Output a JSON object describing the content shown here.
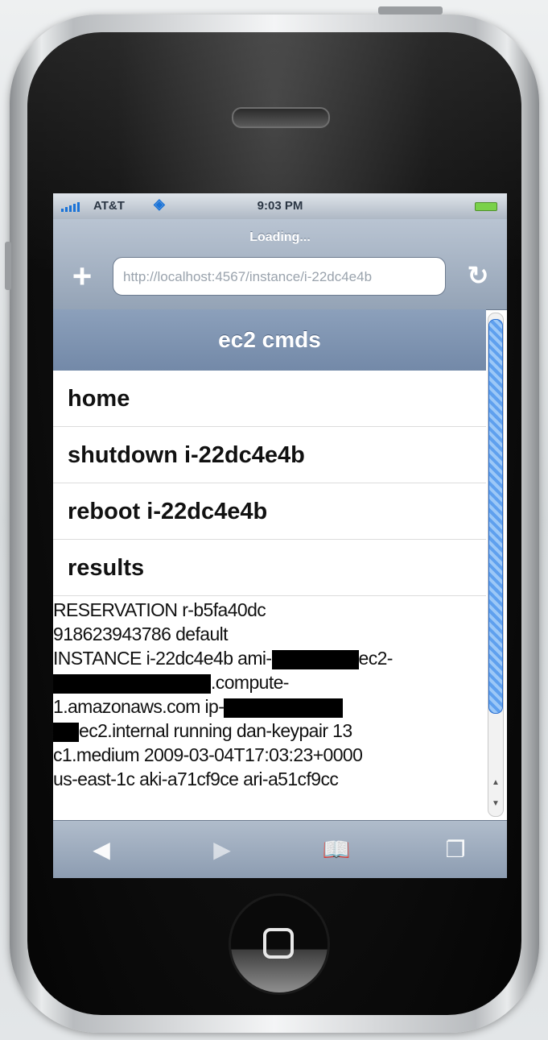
{
  "status_bar": {
    "carrier": "AT&T",
    "time": "9:03 PM"
  },
  "browser": {
    "loading_text": "Loading...",
    "url": "http://localhost:4567/instance/i-22dc4e4b"
  },
  "page": {
    "title": "ec2 cmds",
    "menu_items": [
      {
        "label": "home"
      },
      {
        "label": "shutdown i-22dc4e4b"
      },
      {
        "label": "reboot i-22dc4e4b"
      },
      {
        "label": "results"
      }
    ],
    "results": {
      "line1": "RESERVATION r-b5fa40dc",
      "line2": "918623943786 default",
      "line3_a": "INSTANCE i-22dc4e4b ami-",
      "line3_b": "ec2-",
      "line4_b": ".compute-",
      "line5_a": "1.amazonaws.com ip-",
      "line6_b": "ec2.internal running dan-keypair 13",
      "line7": "c1.medium 2009-03-04T17:03:23+0000",
      "line8": "us-east-1c aki-a71cf9ce ari-a51cf9cc"
    }
  },
  "icons": {
    "add": "plus-icon",
    "reload": "reload-icon",
    "back": "back-arrow-icon",
    "forward": "forward-arrow-icon",
    "bookmarks": "bookmarks-icon",
    "pages": "pages-icon",
    "wifi": "wifi-icon",
    "battery": "battery-icon"
  },
  "colors": {
    "header_bg": "#7f94b2",
    "scroll_thumb": "#5fa0ee",
    "battery": "#7ad14a"
  }
}
